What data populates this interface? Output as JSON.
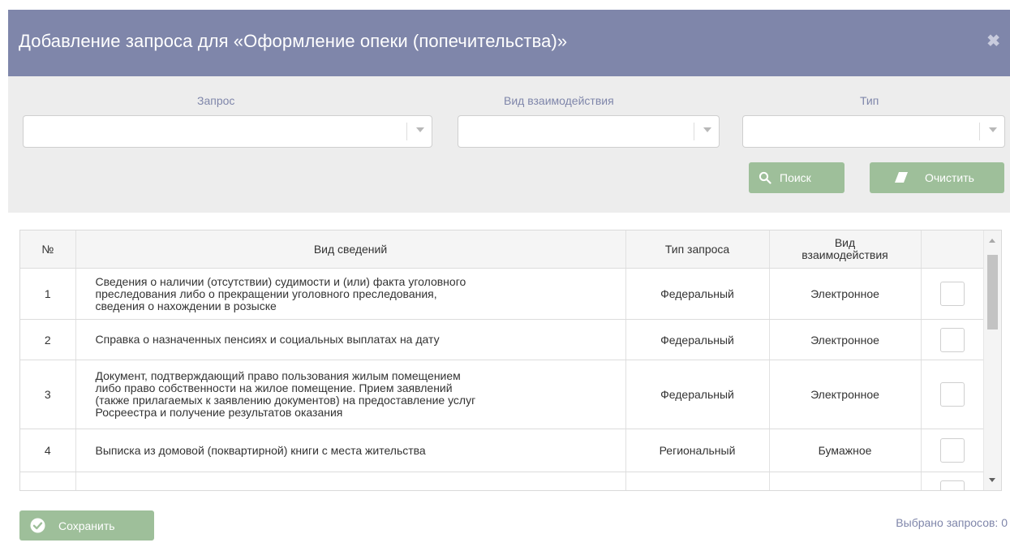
{
  "dialog": {
    "title": "Добавление запроса для «Оформление опеки (попечительства)»",
    "close_icon": "close-icon",
    "colors": {
      "header_bg": "#7f86aa",
      "button_bg": "#9ebf9a",
      "filter_bg": "#ededed",
      "accent_text": "#7f86aa"
    }
  },
  "filters": {
    "request_label": "Запрос",
    "request_value": "",
    "interaction_label": "Вид взаимодействия",
    "interaction_value": "",
    "type_label": "Тип",
    "type_value": "",
    "search_button": "Поиск",
    "search_icon": "search-icon",
    "clear_button": "Очистить",
    "clear_icon": "eraser-icon"
  },
  "table": {
    "headers": {
      "num": "№",
      "kind": "Вид сведений",
      "req_type": "Тип запроса",
      "interaction_line1": "Вид",
      "interaction_line2": "взаимодействия"
    },
    "rows": [
      {
        "num": "1",
        "kind_lines": [
          "Сведения о наличии (отсутствии) судимости и (или) факта уголовного",
          "преследования либо о прекращении уголовного преследования,",
          "сведения о нахождении в розыске"
        ],
        "req_type": "Федеральный",
        "interaction": "Электронное",
        "checked": false
      },
      {
        "num": "2",
        "kind_lines": [
          "Справка о назначенных пенсиях и социальных выплатах на дату"
        ],
        "req_type": "Федеральный",
        "interaction": "Электронное",
        "checked": false
      },
      {
        "num": "3",
        "kind_lines": [
          "Документ, подтверждающий право пользования жилым помещением",
          "либо право собственности на жилое помещение. Прием заявлений",
          "(также прилагаемых к заявлению документов) на предоставление услуг",
          "Росреестра и получение результатов оказания"
        ],
        "req_type": "Федеральный",
        "interaction": "Электронное",
        "checked": false
      },
      {
        "num": "4",
        "kind_lines": [
          "Выписка из домовой (поквартирной) книги с места жительства"
        ],
        "req_type": "Региональный",
        "interaction": "Бумажное",
        "checked": false
      }
    ]
  },
  "footer": {
    "save_button": "Сохранить",
    "save_icon": "check-circle-icon",
    "selected_count": "Выбрано запросов: 0"
  }
}
